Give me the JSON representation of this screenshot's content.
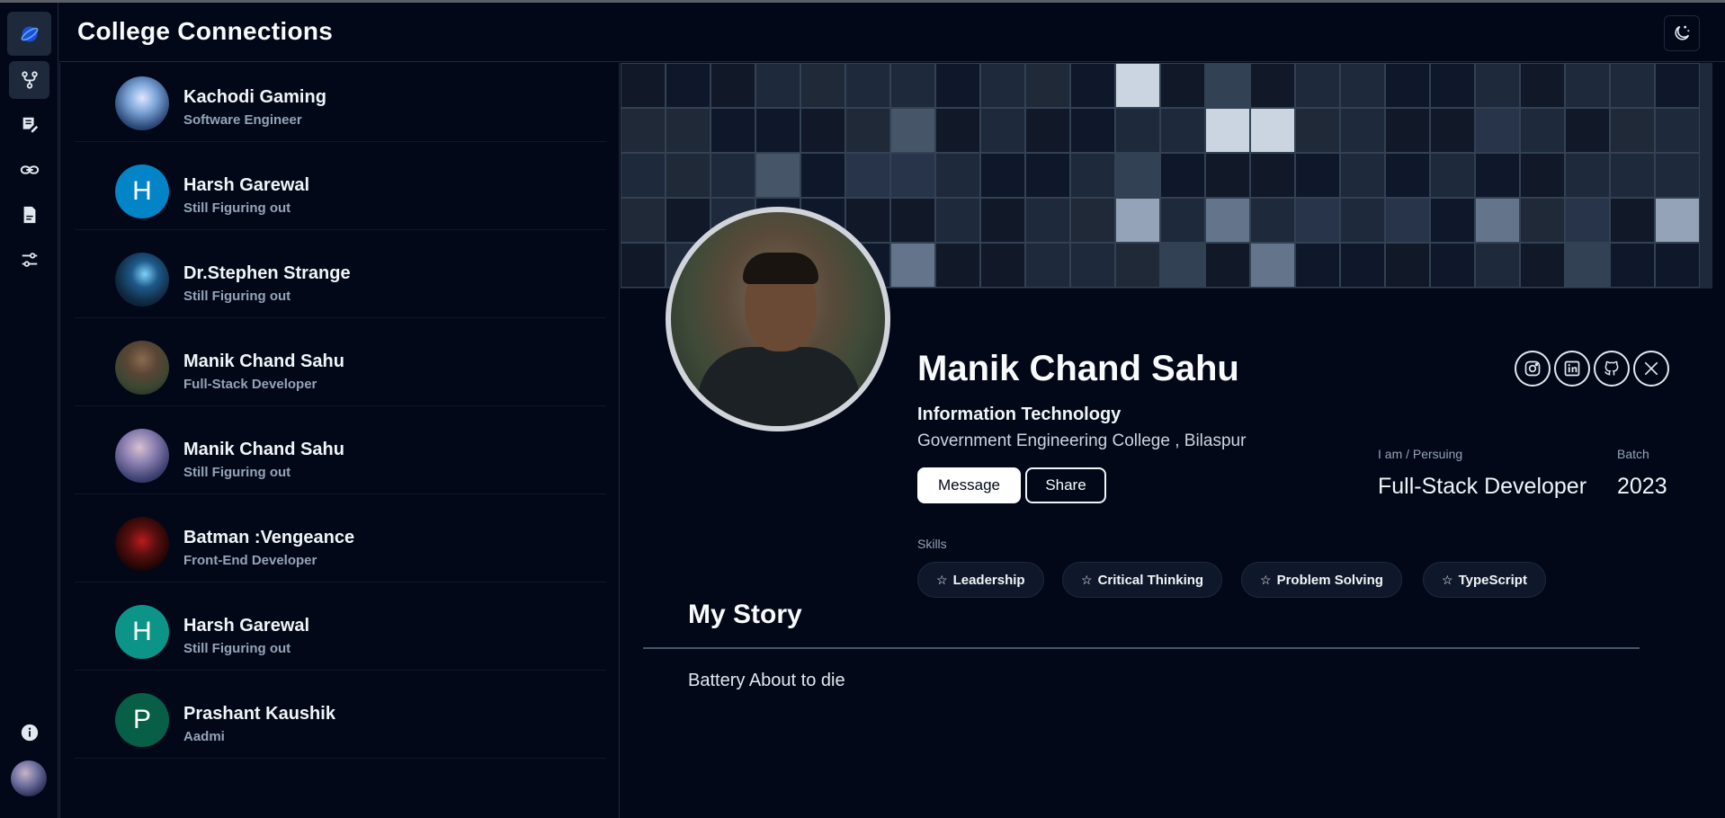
{
  "app": {
    "title": "College Connections",
    "logo_icon": "logo-icon",
    "theme_icon": "moon-stars-icon"
  },
  "rail": {
    "items": [
      {
        "icon": "branch-icon",
        "active": true
      },
      {
        "icon": "notes-icon",
        "active": false
      },
      {
        "icon": "link-icon",
        "active": false
      },
      {
        "icon": "document-icon",
        "active": false
      },
      {
        "icon": "sliders-icon",
        "active": false
      }
    ],
    "info_icon": "info-icon",
    "avatar_icon": "user-avatar"
  },
  "contacts": [
    {
      "name": "Kachodi Gaming",
      "role": "Software Engineer",
      "avatar": "image",
      "color": "#4a6fa5"
    },
    {
      "name": "Harsh Garewal",
      "role": "Still Figuring out",
      "avatar": "H",
      "color": "#0284c7"
    },
    {
      "name": "Dr.Stephen Strange",
      "role": "Still Figuring out",
      "avatar": "image",
      "color": "#1e3a5f"
    },
    {
      "name": "Manik Chand Sahu",
      "role": "Full-Stack Developer",
      "avatar": "image",
      "color": "#5b4a3a"
    },
    {
      "name": "Manik Chand Sahu",
      "role": "Still Figuring out",
      "avatar": "image",
      "color": "#6d6f9e"
    },
    {
      "name": "Batman :Vengeance",
      "role": "Front-End Developer",
      "avatar": "image",
      "color": "#3a0d0d"
    },
    {
      "name": "Harsh Garewal",
      "role": "Still Figuring out",
      "avatar": "H",
      "color": "#0d9488"
    },
    {
      "name": "Prashant Kaushik",
      "role": "Aadmi",
      "avatar": "P",
      "color": "#065f46"
    }
  ],
  "profile": {
    "name": "Manik Chand Sahu",
    "department": "Information Technology",
    "college": "Government Engineering College , Bilaspur",
    "message_label": "Message",
    "share_label": "Share",
    "pursuing_label": "I am / Persuing",
    "pursuing_value": "Full-Stack Developer",
    "batch_label": "Batch",
    "batch_value": "2023",
    "skills_label": "Skills",
    "skills": [
      "Leadership",
      "Critical Thinking",
      "Problem Solving",
      "TypeScript"
    ],
    "social": [
      "instagram-icon",
      "linkedin-icon",
      "github-icon",
      "x-icon"
    ],
    "story_title": "My Story",
    "story_text": "Battery About to die"
  },
  "colors": {
    "background": "#020817",
    "border": "#1e293b",
    "muted_text": "#94a3b8"
  }
}
